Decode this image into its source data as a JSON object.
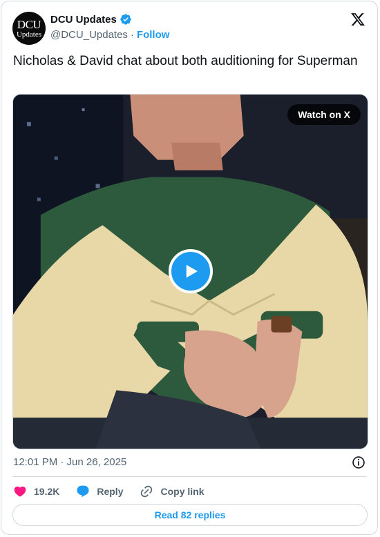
{
  "author": {
    "avatar_line1": "DCU",
    "avatar_line2": "Updates",
    "display_name": "DCU Updates",
    "handle": "@DCU_Updates",
    "separator": "·",
    "follow_label": "Follow",
    "verified": true
  },
  "tweet": {
    "text": "Nicholas & David chat about both auditioning for Superman",
    "timestamp": "12:01 PM · Jun 26, 2025"
  },
  "media": {
    "watch_label": "Watch on X",
    "type": "video"
  },
  "actions": {
    "like_count": "19.2K",
    "reply_label": "Reply",
    "copy_link_label": "Copy link"
  },
  "footer": {
    "read_replies_label": "Read 82 replies"
  },
  "colors": {
    "accent": "#1d9bf0",
    "like": "#f91880",
    "muted_text": "#536471",
    "border": "#cfd9de"
  },
  "icons": [
    "verified-badge-icon",
    "x-logo-icon",
    "play-icon",
    "info-icon",
    "heart-icon",
    "reply-bubble-icon",
    "link-icon"
  ]
}
